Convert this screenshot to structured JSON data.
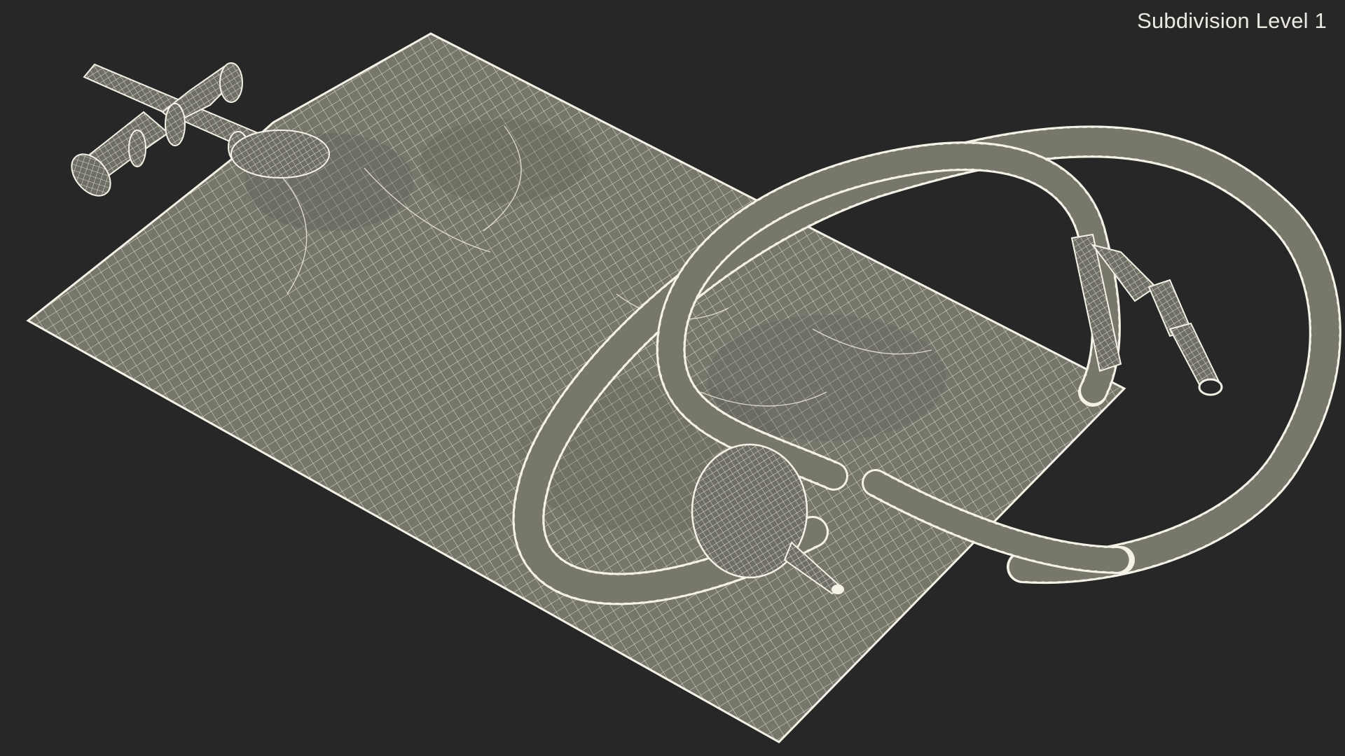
{
  "viewport": {
    "label": "Subdivision Level 1",
    "colors": {
      "background": "#272727",
      "surface": "#76766b",
      "surface_shade": "#5f5f56",
      "wire": "#f4f1e6",
      "label": "#ece9e3"
    }
  },
  "model": {
    "parts": [
      "bag",
      "outlet-valve",
      "drain-tube",
      "bulb",
      "connector"
    ]
  }
}
